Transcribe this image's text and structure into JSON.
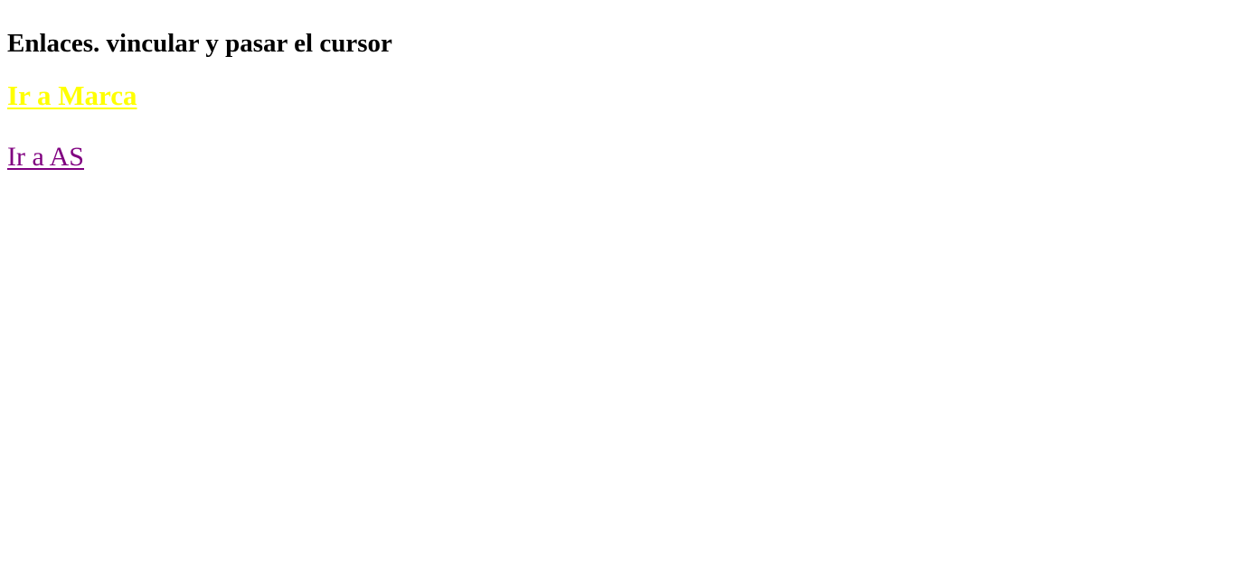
{
  "heading": "Enlaces. vincular y pasar el cursor",
  "links": [
    {
      "label": "Ir a Marca",
      "color": "#ffff00",
      "state": "hover"
    },
    {
      "label": "Ir a AS",
      "color": "#800080",
      "state": "visited"
    }
  ]
}
